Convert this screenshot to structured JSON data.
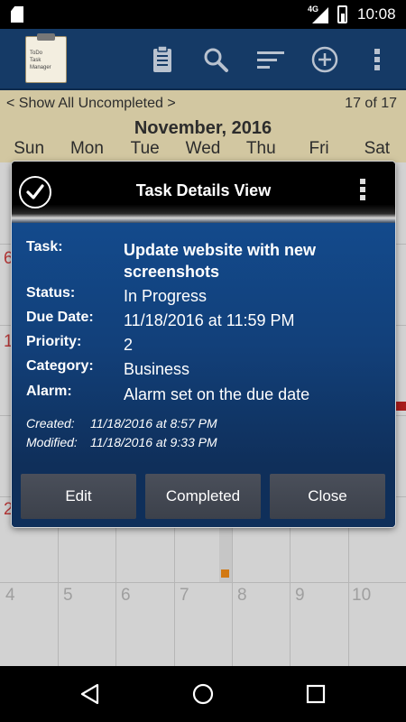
{
  "status_bar": {
    "network": "4G",
    "time": "10:08"
  },
  "app_bar": {
    "logo_lines": [
      "ToDo",
      "Task",
      "Manager"
    ],
    "icons": [
      "clipboard-icon",
      "search-icon",
      "sort-icon",
      "add-icon",
      "overflow-menu-icon"
    ]
  },
  "calendar": {
    "filter_left": "< Show All Uncompleted >",
    "filter_right": "17 of 17",
    "month": "November, 2016",
    "weekdays": [
      "Sun",
      "Mon",
      "Tue",
      "Wed",
      "Thu",
      "Fri",
      "Sat"
    ],
    "bottom_row_days": [
      "4",
      "5",
      "6",
      "7",
      "8",
      "9",
      "10"
    ],
    "left_partial_days": [
      "6",
      "1",
      "2"
    ],
    "accent_color": "#f08a16"
  },
  "dialog": {
    "title": "Task Details View",
    "fields": [
      {
        "label": "Task:",
        "value": "Update website with new screenshots"
      },
      {
        "label": "Status:",
        "value": "In Progress"
      },
      {
        "label": "Due Date:",
        "value": "11/18/2016 at 11:59 PM"
      },
      {
        "label": "Priority:",
        "value": "2"
      },
      {
        "label": "Category:",
        "value": "Business"
      },
      {
        "label": "Alarm:",
        "value": "Alarm set on the due date"
      }
    ],
    "created_label": "Created:",
    "created_value": "11/18/2016 at 8:57 PM",
    "modified_label": "Modified:",
    "modified_value": "11/18/2016 at 9:33 PM",
    "buttons": {
      "edit": "Edit",
      "completed": "Completed",
      "close": "Close"
    }
  }
}
